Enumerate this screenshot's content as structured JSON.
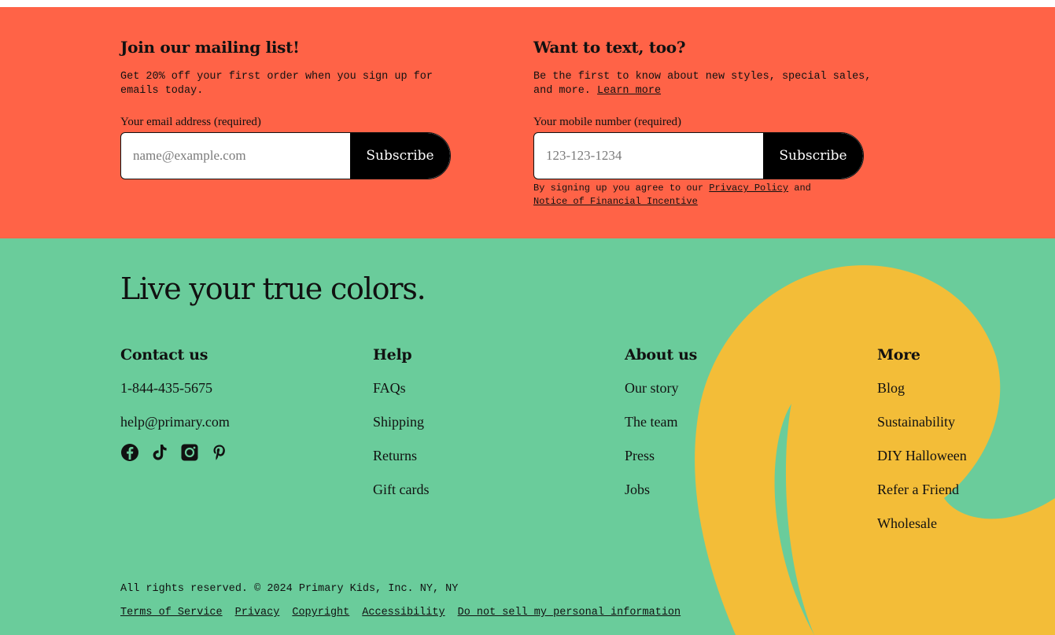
{
  "mailing": {
    "title": "Join our mailing list!",
    "description": "Get 20% off your first order when you sign up for emails today.",
    "label": "Your email address (required)",
    "placeholder": "name@example.com",
    "button": "Subscribe"
  },
  "text": {
    "title": "Want to text, too?",
    "description": "Be the first to know about new styles, special sales, and more.",
    "learn_more": "Learn more",
    "label": "Your mobile number (required)",
    "placeholder": "123-123-1234",
    "button": "Subscribe",
    "consent_prefix": "By signing up you agree to our",
    "privacy_link": "Privacy Policy",
    "consent_and": "and",
    "financial_link": "Notice of Financial Incentive"
  },
  "footer": {
    "tagline": "Live your true colors.",
    "columns": [
      {
        "title": "Contact us",
        "items": [
          "1-844-435-5675",
          "help@primary.com"
        ]
      },
      {
        "title": "Help",
        "items": [
          "FAQs",
          "Shipping",
          "Returns",
          "Gift cards"
        ]
      },
      {
        "title": "About us",
        "items": [
          "Our story",
          "The team",
          "Press",
          "Jobs"
        ]
      },
      {
        "title": "More",
        "items": [
          "Blog",
          "Sustainability",
          "DIY Halloween",
          "Refer a Friend",
          "Wholesale"
        ]
      }
    ],
    "socials": [
      "facebook-icon",
      "tiktok-icon",
      "instagram-icon",
      "pinterest-icon"
    ],
    "copyright": "All rights reserved. © 2024 Primary Kids, Inc. NY, NY",
    "legal_links": [
      "Terms of Service",
      "Privacy",
      "Copyright",
      "Accessibility",
      "Do not sell my personal information"
    ]
  },
  "colors": {
    "signup_bg": "#ff6347",
    "footer_bg": "#6acc9b",
    "swirl": "#f3bd38",
    "button": "#000000"
  }
}
